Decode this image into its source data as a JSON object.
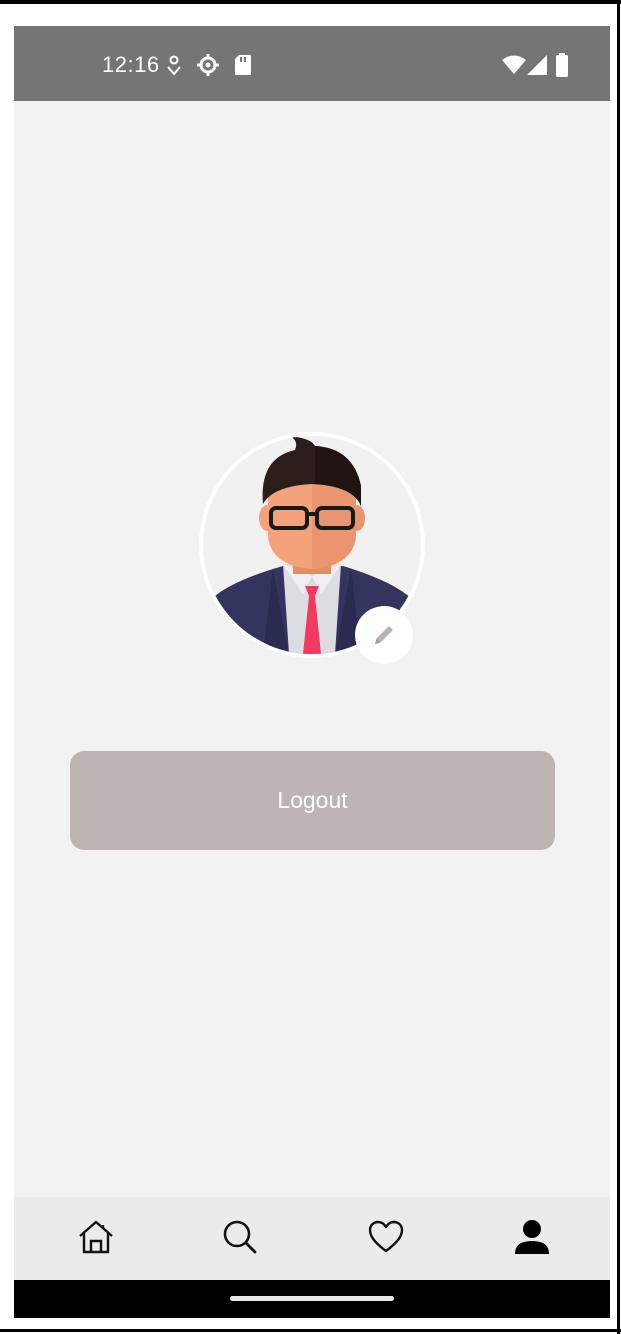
{
  "status_bar": {
    "time": "12:16",
    "left_icons": [
      "location-pin-icon",
      "settings-gear-icon",
      "sd-card-icon"
    ],
    "right_icons": [
      "wifi-icon",
      "cell-signal-icon",
      "battery-icon"
    ],
    "background": "#757575"
  },
  "profile": {
    "avatar_icon": "businessman-avatar-icon",
    "edit_icon": "pencil-icon"
  },
  "actions": {
    "logout_label": "Logout",
    "logout_color": "#beb4b4"
  },
  "bottom_nav": {
    "items": [
      {
        "icon": "home-icon",
        "active": false
      },
      {
        "icon": "search-icon",
        "active": false
      },
      {
        "icon": "heart-icon",
        "active": false
      },
      {
        "icon": "profile-icon",
        "active": true
      }
    ]
  },
  "colors": {
    "screen_background": "#f2f2f2",
    "nav_background": "#ebebeb",
    "suit": "#34355f",
    "tie": "#f23a61",
    "skin": "#f4a27a",
    "hair": "#2b1d1a"
  }
}
